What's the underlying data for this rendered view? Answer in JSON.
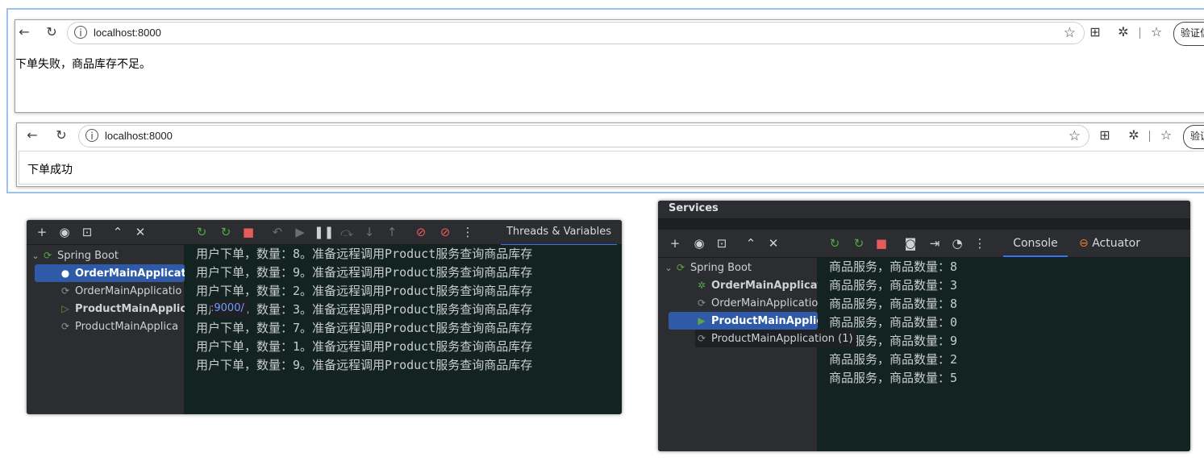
{
  "browser1": {
    "url": "localhost:8000",
    "verify_label": "验证信",
    "message": "下单失败，商品库存不足。"
  },
  "browser2": {
    "url": "localhost:8000",
    "verify_label": "验证",
    "message": "下单成功"
  },
  "left_panel": {
    "tab_label": "Threads & Variables",
    "tree": [
      {
        "label": "Spring Boot"
      },
      {
        "label": "OrderMainApplicati"
      },
      {
        "label": "OrderMainApplicatio"
      },
      {
        "label": "ProductMainApplication",
        "port": ":9000/"
      },
      {
        "label": "ProductMainApplica"
      }
    ],
    "console": [
      "用户下单，数量：8。准备远程调用Product服务查询商品库存",
      "用户下单，数量：9。准备远程调用Product服务查询商品库存",
      "用户下单，数量：2。准备远程调用Product服务查询商品库存",
      "用户下单，数量：3。准备远程调用Product服务查询商品库存",
      "用户下单，数量：7。准备远程调用Product服务查询商品库存",
      "用户下单，数量：1。准备远程调用Product服务查询商品库存",
      "用户下单，数量：9。准备远程调用Product服务查询商品库存"
    ]
  },
  "right_panel": {
    "title": "Services",
    "tabs": [
      "Console",
      "Actuator"
    ],
    "tree": [
      {
        "label": "Spring Boot"
      },
      {
        "label": "OrderMainApplicati"
      },
      {
        "label": "OrderMainApplicatio"
      },
      {
        "label": "ProductMainApplica"
      },
      {
        "label": "ProductMainApplication (1)"
      }
    ],
    "console": [
      "商品服务，商品数量：8",
      "商品服务，商品数量：3",
      "商品服务，商品数量：8",
      "商品服务，商品数量：0",
      "商品服务，商品数量：9",
      "商品服务，商品数量：2",
      "商品服务，商品数量：5"
    ]
  },
  "colors": {
    "selection": "#2e5aa7",
    "console_bg": "#132321",
    "panel_bg": "#2b2d30",
    "accent_tab": "#3574f0"
  }
}
